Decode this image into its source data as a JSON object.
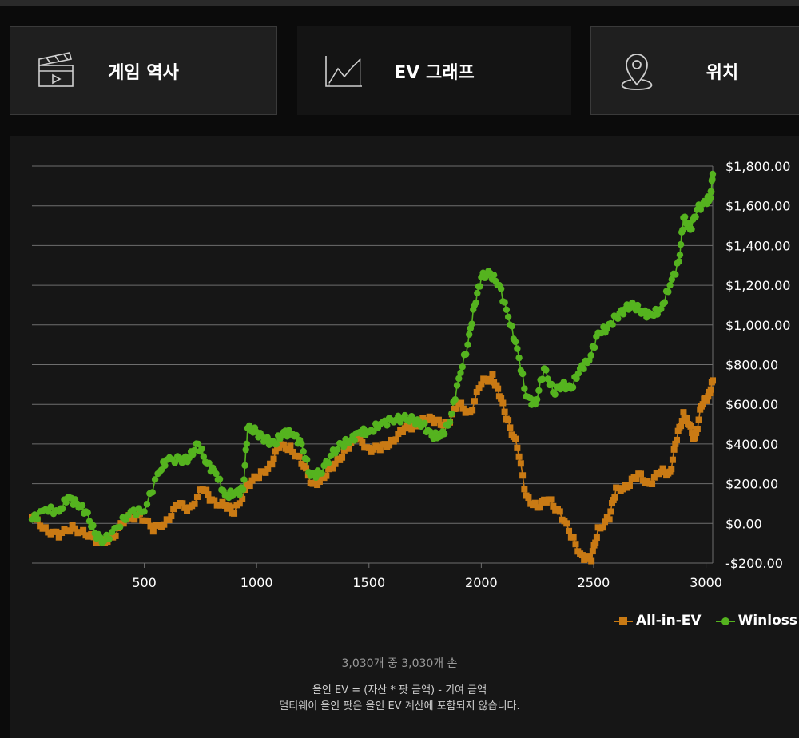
{
  "tabs": [
    {
      "label": "게임 역사",
      "icon": "clapperboard-icon"
    },
    {
      "label": "EV 그래프",
      "icon": "line-chart-icon"
    },
    {
      "label": "위치",
      "icon": "location-pin-icon"
    }
  ],
  "colors": {
    "allin": "#c97a14",
    "winloss": "#55b31f",
    "grid": "#6e6e6e"
  },
  "legend": {
    "allin": "All-in-EV",
    "winloss": "Winloss"
  },
  "footer": {
    "count": "3,030개 중 3,030개 손",
    "formula": "올인 EV = (자산 * 팟 금액) - 기여 금액",
    "note": "멀티웨이 올인 팟은 올인 EV 계산에 포함되지 않습니다."
  },
  "chart_data": {
    "type": "line",
    "xlim": [
      0,
      3030
    ],
    "ylim": [
      -200,
      1800
    ],
    "x_ticks": [
      "500",
      "1000",
      "1500",
      "2000",
      "2500",
      "3000"
    ],
    "x_tick_values": [
      500,
      1000,
      1500,
      2000,
      2500,
      3000
    ],
    "y_ticks": [
      "$1,800.00",
      "$1,600.00",
      "$1,400.00",
      "$1,200.00",
      "$1,000.00",
      "$800.00",
      "$600.00",
      "$400.00",
      "$200.00",
      "$0.00",
      "-$200.00"
    ],
    "y_tick_values": [
      1800,
      1600,
      1400,
      1200,
      1000,
      800,
      600,
      400,
      200,
      0,
      -200
    ],
    "grid": true,
    "legend_position": "bottom-right",
    "series": [
      {
        "name": "All-in-EV",
        "color": "#c97a14",
        "marker": "square",
        "points": [
          [
            0,
            30
          ],
          [
            60,
            -20
          ],
          [
            120,
            -70
          ],
          [
            180,
            -10
          ],
          [
            240,
            -60
          ],
          [
            300,
            -90
          ],
          [
            360,
            -70
          ],
          [
            420,
            20
          ],
          [
            480,
            50
          ],
          [
            540,
            -40
          ],
          [
            600,
            20
          ],
          [
            650,
            90
          ],
          [
            700,
            80
          ],
          [
            760,
            170
          ],
          [
            800,
            120
          ],
          [
            860,
            90
          ],
          [
            900,
            50
          ],
          [
            960,
            200
          ],
          [
            1010,
            230
          ],
          [
            1060,
            300
          ],
          [
            1100,
            380
          ],
          [
            1150,
            390
          ],
          [
            1200,
            300
          ],
          [
            1250,
            200
          ],
          [
            1300,
            230
          ],
          [
            1350,
            300
          ],
          [
            1400,
            380
          ],
          [
            1450,
            430
          ],
          [
            1500,
            380
          ],
          [
            1550,
            370
          ],
          [
            1600,
            420
          ],
          [
            1650,
            460
          ],
          [
            1700,
            500
          ],
          [
            1750,
            520
          ],
          [
            1800,
            520
          ],
          [
            1850,
            500
          ],
          [
            1900,
            600
          ],
          [
            1950,
            560
          ],
          [
            2000,
            700
          ],
          [
            2050,
            750
          ],
          [
            2080,
            640
          ],
          [
            2120,
            520
          ],
          [
            2160,
            380
          ],
          [
            2200,
            140
          ],
          [
            2250,
            80
          ],
          [
            2300,
            120
          ],
          [
            2350,
            60
          ],
          [
            2400,
            -70
          ],
          [
            2450,
            -160
          ],
          [
            2490,
            -190
          ],
          [
            2520,
            -20
          ],
          [
            2570,
            20
          ],
          [
            2600,
            180
          ],
          [
            2650,
            180
          ],
          [
            2700,
            250
          ],
          [
            2750,
            200
          ],
          [
            2800,
            260
          ],
          [
            2840,
            260
          ],
          [
            2870,
            420
          ],
          [
            2900,
            560
          ],
          [
            2920,
            500
          ],
          [
            2950,
            430
          ],
          [
            2980,
            590
          ],
          [
            3010,
            640
          ],
          [
            3030,
            720
          ]
        ]
      },
      {
        "name": "Winloss",
        "color": "#55b31f",
        "marker": "circle",
        "points": [
          [
            0,
            20
          ],
          [
            60,
            70
          ],
          [
            120,
            60
          ],
          [
            160,
            130
          ],
          [
            200,
            100
          ],
          [
            240,
            60
          ],
          [
            280,
            -50
          ],
          [
            320,
            -90
          ],
          [
            380,
            -20
          ],
          [
            440,
            60
          ],
          [
            500,
            60
          ],
          [
            560,
            250
          ],
          [
            600,
            320
          ],
          [
            660,
            320
          ],
          [
            700,
            330
          ],
          [
            740,
            400
          ],
          [
            780,
            300
          ],
          [
            820,
            250
          ],
          [
            860,
            140
          ],
          [
            900,
            150
          ],
          [
            940,
            170
          ],
          [
            960,
            480
          ],
          [
            1000,
            460
          ],
          [
            1040,
            420
          ],
          [
            1080,
            400
          ],
          [
            1120,
            460
          ],
          [
            1160,
            450
          ],
          [
            1200,
            400
          ],
          [
            1240,
            240
          ],
          [
            1280,
            250
          ],
          [
            1330,
            340
          ],
          [
            1380,
            400
          ],
          [
            1420,
            420
          ],
          [
            1460,
            460
          ],
          [
            1500,
            460
          ],
          [
            1550,
            500
          ],
          [
            1600,
            520
          ],
          [
            1650,
            530
          ],
          [
            1700,
            520
          ],
          [
            1740,
            500
          ],
          [
            1780,
            440
          ],
          [
            1820,
            440
          ],
          [
            1860,
            510
          ],
          [
            1900,
            730
          ],
          [
            1940,
            900
          ],
          [
            1970,
            1100
          ],
          [
            2000,
            1240
          ],
          [
            2040,
            1260
          ],
          [
            2080,
            1200
          ],
          [
            2120,
            1040
          ],
          [
            2160,
            880
          ],
          [
            2200,
            640
          ],
          [
            2240,
            600
          ],
          [
            2280,
            780
          ],
          [
            2320,
            660
          ],
          [
            2360,
            700
          ],
          [
            2400,
            680
          ],
          [
            2440,
            780
          ],
          [
            2480,
            820
          ],
          [
            2520,
            960
          ],
          [
            2560,
            980
          ],
          [
            2600,
            1040
          ],
          [
            2640,
            1080
          ],
          [
            2680,
            1100
          ],
          [
            2720,
            1060
          ],
          [
            2760,
            1050
          ],
          [
            2800,
            1080
          ],
          [
            2840,
            1200
          ],
          [
            2880,
            1320
          ],
          [
            2900,
            1540
          ],
          [
            2930,
            1480
          ],
          [
            2960,
            1580
          ],
          [
            3000,
            1620
          ],
          [
            3020,
            1640
          ],
          [
            3030,
            1760
          ]
        ]
      }
    ]
  }
}
